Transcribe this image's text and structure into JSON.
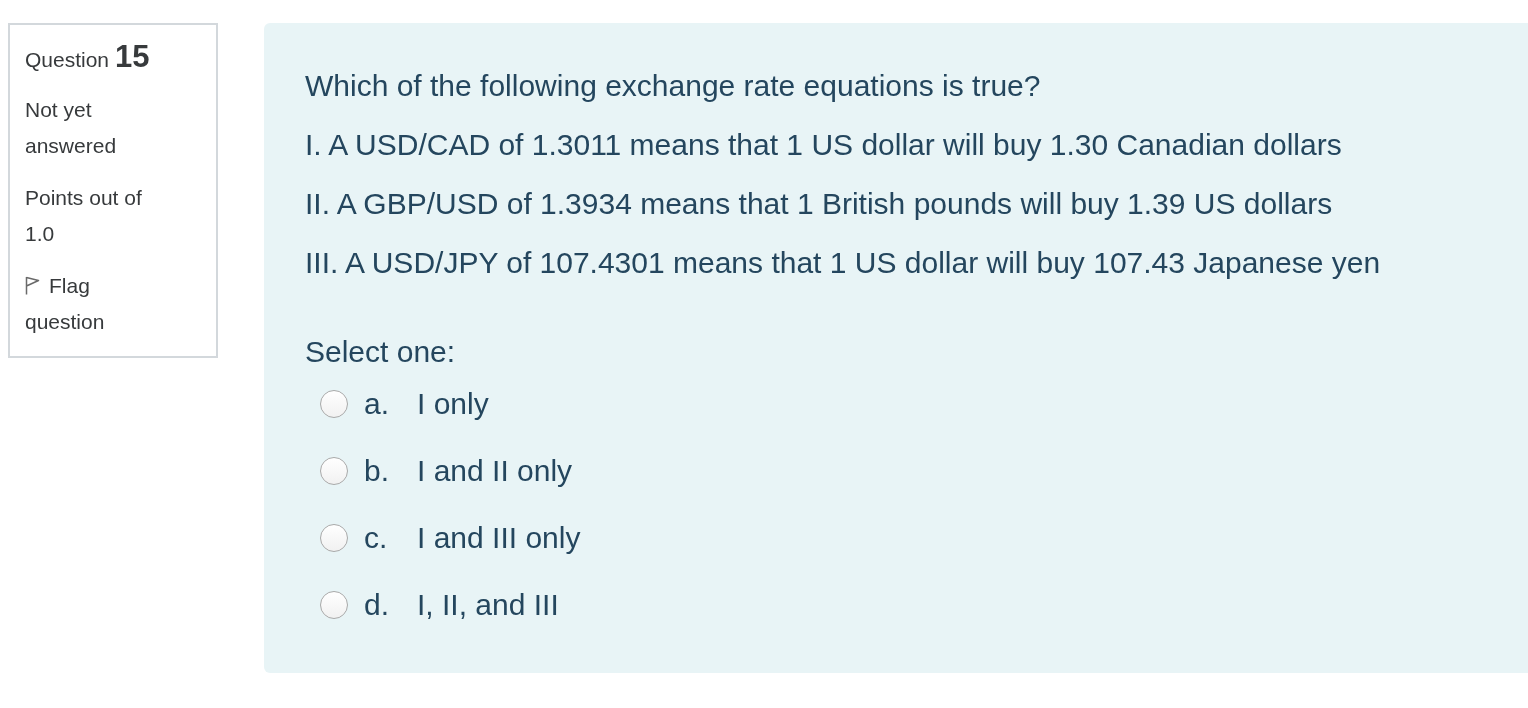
{
  "question_info": {
    "label": "Question",
    "number": "15",
    "status": "Not yet answered",
    "points": "Points out of 1.0",
    "flag": {
      "label": "Flag question",
      "flagged": false
    }
  },
  "question": {
    "prompt": "Which of the following exchange rate equations is true?",
    "statements": [
      "I. A USD/CAD of 1.3011 means that 1 US dollar will buy 1.30 Canadian dollars",
      "II. A GBP/USD of 1.3934 means that 1 British pounds will buy 1.39 US dollars",
      "III. A USD/JPY of 107.4301 means that 1 US dollar will buy 107.43 Japanese yen"
    ],
    "instruction": "Select one:",
    "options": [
      {
        "letter": "a.",
        "text": "I only",
        "selected": false
      },
      {
        "letter": "b.",
        "text": "I and II only",
        "selected": false
      },
      {
        "letter": "c.",
        "text": "I and III only",
        "selected": false
      },
      {
        "letter": "d.",
        "text": "I, II, and III",
        "selected": false
      }
    ]
  }
}
